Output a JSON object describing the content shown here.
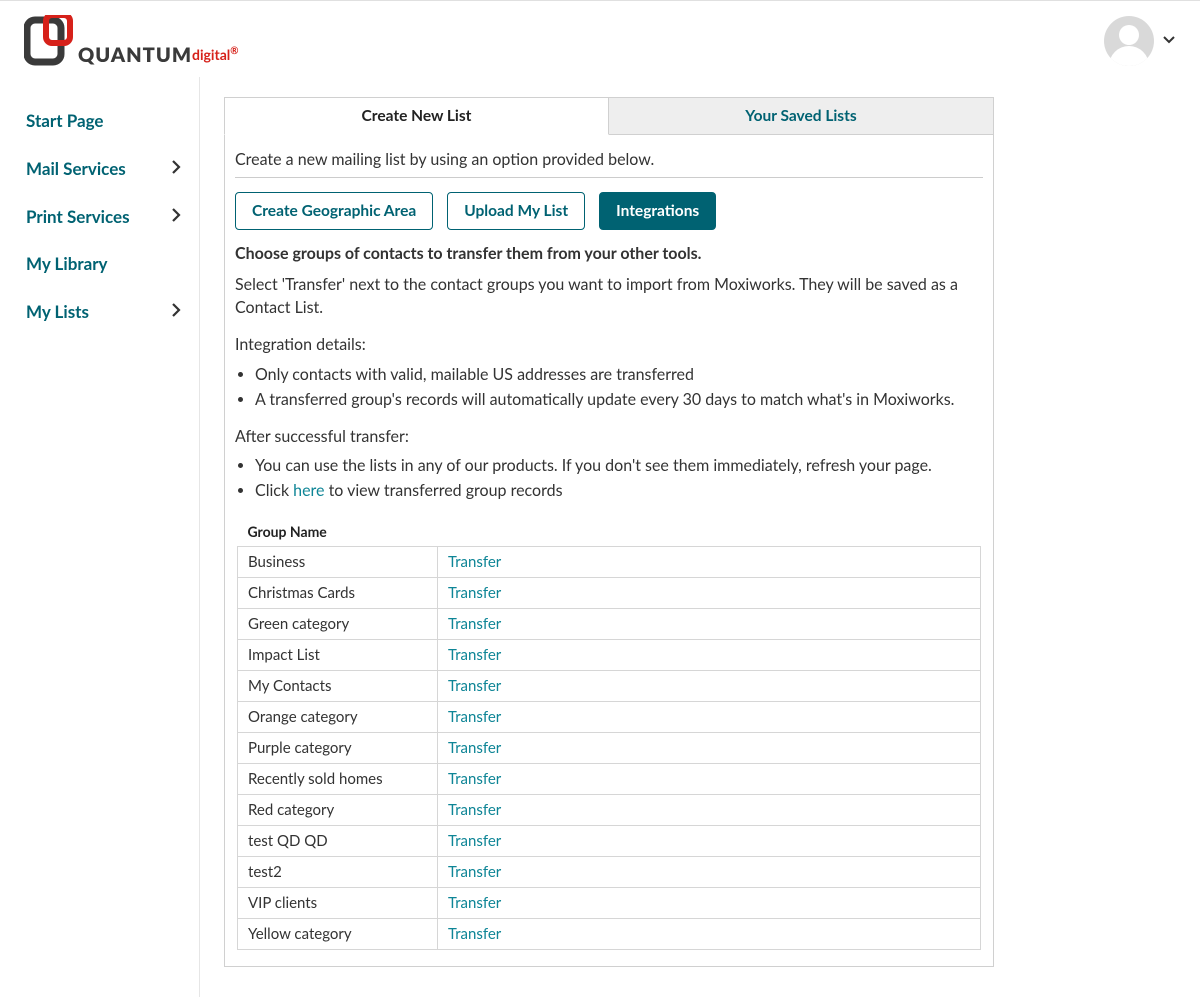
{
  "brand": {
    "name": "QUANTUM",
    "suffix": "digital",
    "reg": "®"
  },
  "sidebar": {
    "items": [
      {
        "label": "Start Page",
        "has_children": false
      },
      {
        "label": "Mail Services",
        "has_children": true
      },
      {
        "label": "Print Services",
        "has_children": true
      },
      {
        "label": "My Library",
        "has_children": false
      },
      {
        "label": "My Lists",
        "has_children": true
      }
    ]
  },
  "tabs": {
    "create": "Create New List",
    "saved": "Your Saved Lists"
  },
  "panel": {
    "intro": "Create a new mailing list by using an option provided below.",
    "subtabs": {
      "geo": "Create Geographic Area",
      "upload": "Upload My List",
      "integrations": "Integrations"
    },
    "heading": "Choose groups of contacts to transfer them from your other tools.",
    "desc": "Select 'Transfer' next to the contact groups you want to import from Moxiworks. They will be saved as a Contact List.",
    "details_label": "Integration details:",
    "details": [
      "Only contacts with valid, mailable US addresses are transferred",
      "A transferred group's records will automatically update every 30 days to match what's in Moxiworks."
    ],
    "after_label": "After successful transfer:",
    "after": [
      "You can use the lists in any of our products. If you don't see them immediately, refresh your page."
    ],
    "after_click_prefix": "Click ",
    "after_click_link": "here",
    "after_click_suffix": " to view transferred group records",
    "table": {
      "header": "Group Name",
      "transfer_label": "Transfer",
      "rows": [
        "Business",
        "Christmas Cards",
        "Green category",
        "Impact List",
        "My Contacts",
        "Orange category",
        "Purple category",
        "Recently sold homes",
        "Red category",
        "test QD QD",
        "test2",
        "VIP clients",
        "Yellow category"
      ]
    }
  }
}
